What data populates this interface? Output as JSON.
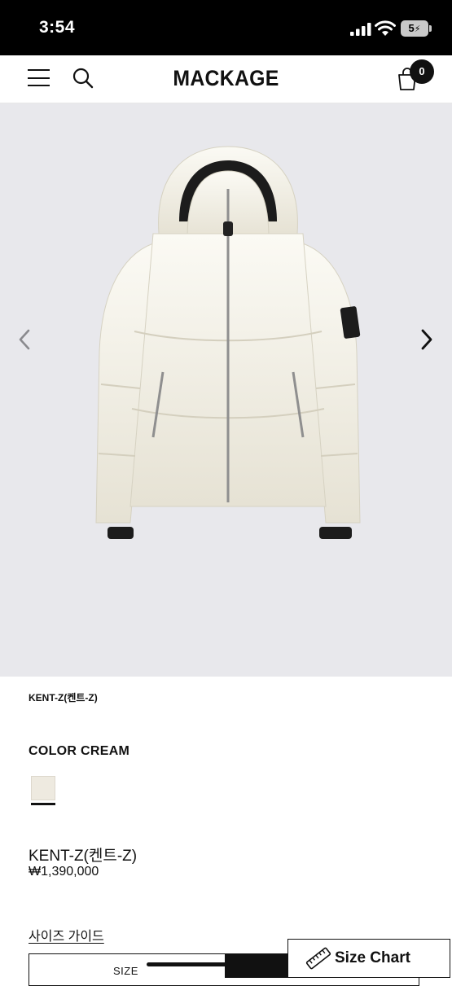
{
  "status_bar": {
    "time": "3:54",
    "battery": "5"
  },
  "header": {
    "brand": "MACKAGE",
    "cart_count": "0"
  },
  "icons": {
    "menu": "hamburger-menu-icon",
    "search": "search-icon",
    "cart": "shopping-bag-icon",
    "prev": "chevron-left-icon",
    "next": "chevron-right-icon",
    "ruler": "ruler-icon"
  },
  "product": {
    "breadcrumb": "KENT-Z(켄트-Z)",
    "color_label": "COLOR CREAM",
    "name": "KENT-Z(켄트-Z)",
    "price": "₩1,390,000",
    "swatch_color": "#eeeae0"
  },
  "size": {
    "guide_link": "사이즈 가이드",
    "table_header": "SIZE",
    "chart_button": "Size Chart"
  },
  "colors": {
    "image_bg": "#e8e8ec",
    "jacket": "#f3f1e8",
    "text": "#111111"
  }
}
